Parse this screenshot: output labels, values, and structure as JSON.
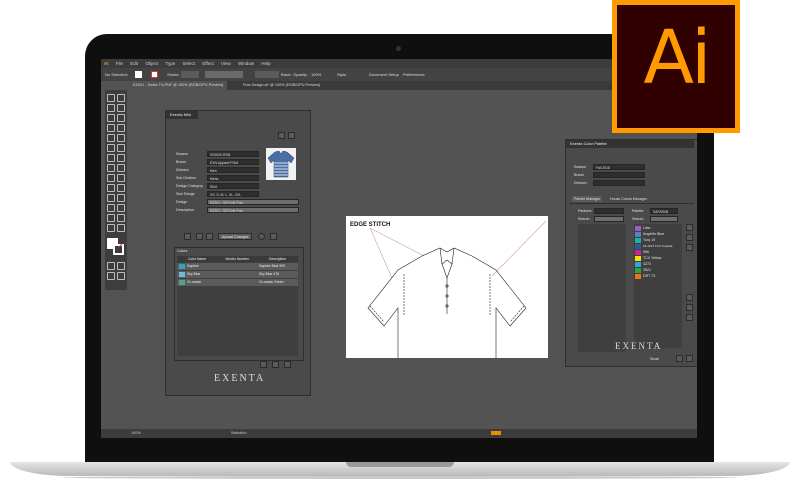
{
  "app_logo": {
    "text": "Ai"
  },
  "menubar": {
    "app": "Ai",
    "items": [
      "File",
      "Edit",
      "Object",
      "Type",
      "Select",
      "Effect",
      "View",
      "Window",
      "Help"
    ]
  },
  "control_bar": {
    "selection": "No Selection",
    "stroke_label": "Stroke:",
    "basic_label": "Basic",
    "opacity_label": "Opacity:",
    "opacity_value": "100%",
    "style_label": "Style:",
    "doc_setup": "Document Setup",
    "preferences": "Preferences"
  },
  "tabs": [
    {
      "label": "EZ001 - Swiss T's.PNF @ 100% (RGB/GPU Preview)"
    },
    {
      "label": "Polo Design.ai* @ 100% (RGB/GPU Preview)"
    }
  ],
  "exenta_mini": {
    "title": "Exenta Mini",
    "fields": [
      {
        "label": "Season",
        "value": "SS2020 RSB"
      },
      {
        "label": "Brand",
        "value": "EXN Apparel PGM"
      },
      {
        "label": "Division",
        "value": "Men"
      },
      {
        "label": "Sub Division",
        "value": "Mens"
      },
      {
        "label": "Design Category",
        "value": "Shirt"
      },
      {
        "label": "Size Range",
        "value": "XS, S, M, L, XL, 2XL"
      },
      {
        "label": "Design",
        "value": "EZ001 - S/S Knit Polo"
      },
      {
        "label": "Description",
        "value": "EZ001 - S/S Knit Polo"
      }
    ],
    "upload_button": "Upload Changes",
    "colors_title": "Colors",
    "colors_headers": [
      "Color Name",
      "Vendor Number",
      "Description"
    ],
    "colors_rows": [
      {
        "name": "Saphire",
        "vendor": "",
        "desc": "Saphire Blue 999",
        "color": "#2aa6c4"
      },
      {
        "name": "Sky Blue",
        "vendor": "",
        "desc": "Sky Blue 476",
        "color": "#6fb8de"
      },
      {
        "name": "Gr-ocean",
        "vendor": "",
        "desc": "Gr-ocean Green",
        "color": "#4fa58c"
      }
    ],
    "logo": "EXENTA"
  },
  "artboard": {
    "callout": "EDGE STITCH"
  },
  "palette": {
    "title": "Exenta Color Palette",
    "fields": [
      {
        "label": "Season",
        "value": "Fall 2018"
      },
      {
        "label": "Brand",
        "value": ""
      },
      {
        "label": "Division",
        "value": ""
      }
    ],
    "tabs": [
      "Palette Manager",
      "House Colors Manager"
    ],
    "pms_label": "Pantone:",
    "palette_label": "Palette:",
    "palette_value": "SAFARI/B",
    "search_label": "Search:",
    "colors": [
      {
        "name": "Lilac",
        "color": "#9b5ec0"
      },
      {
        "name": "Angelite Blue",
        "color": "#5a7ec2"
      },
      {
        "name": "Turq 19",
        "color": "#1eb1a3"
      },
      {
        "name": "18-4244 TCX Imperial",
        "color": "#2c5aa0"
      },
      {
        "name": "966",
        "color": "#d0248c"
      },
      {
        "name": "TCX Yellow",
        "color": "#f4e500"
      },
      {
        "name": "4272",
        "color": "#27a7db"
      },
      {
        "name": "3521",
        "color": "#2aa43b"
      },
      {
        "name": "DRT 73",
        "color": "#f37021"
      }
    ],
    "small_label": "Small",
    "logo": "EXENTA"
  },
  "status": {
    "zoom": "100%",
    "mode": "Selection"
  }
}
